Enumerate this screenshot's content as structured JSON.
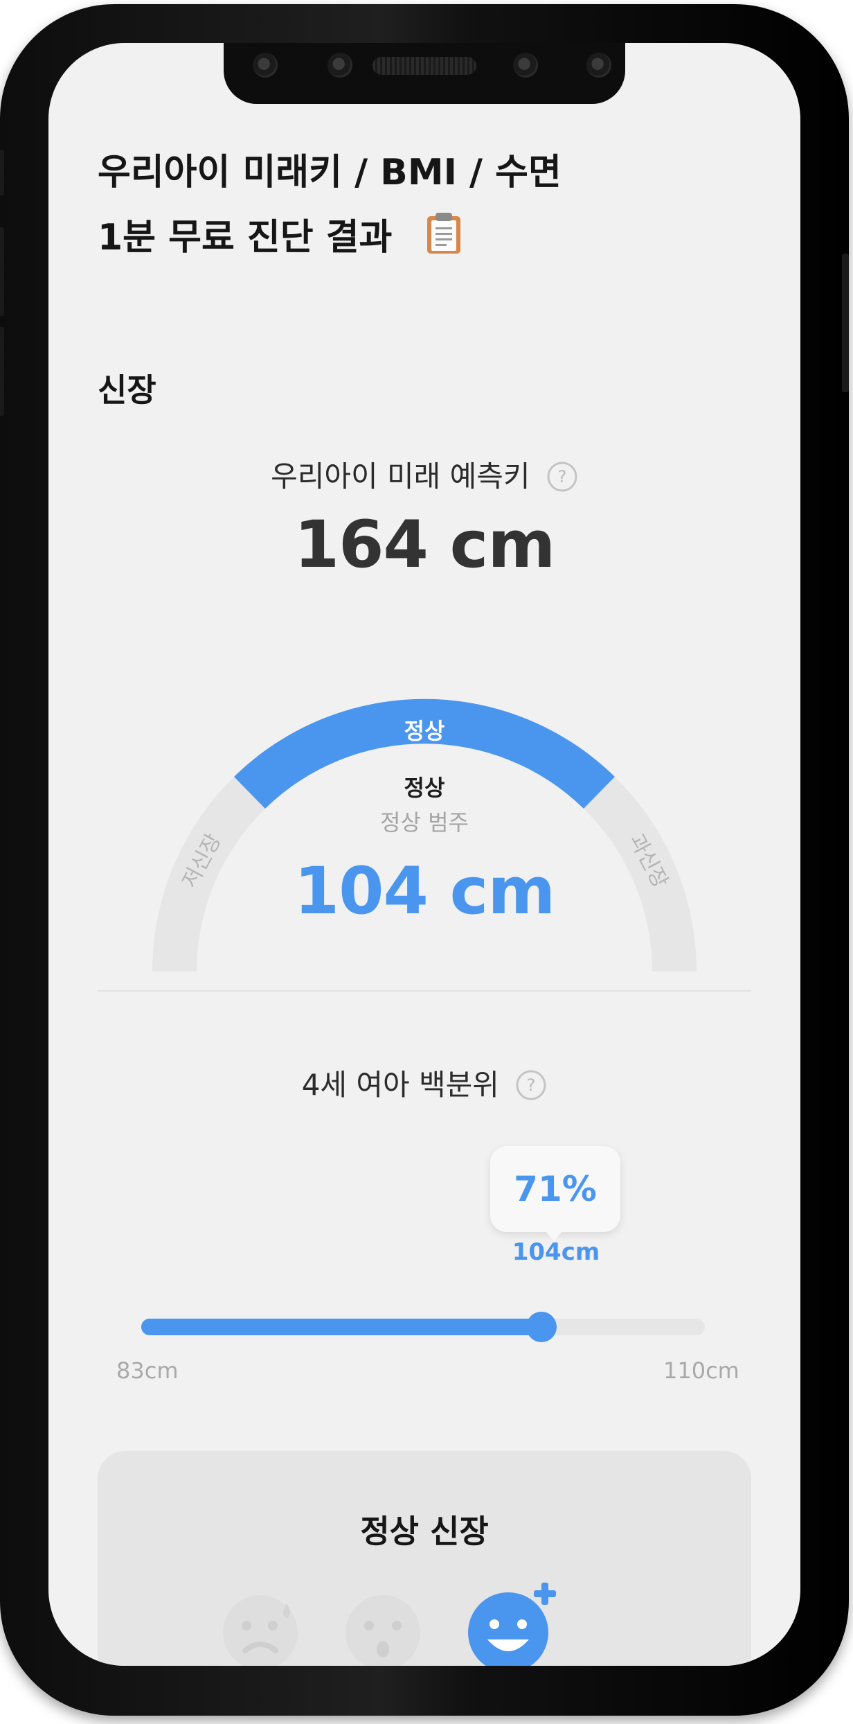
{
  "header": {
    "title": "우리아이 미래키 / BMI / 수면\n1분 무료 진단 결과"
  },
  "height_section": {
    "title": "신장",
    "prediction_label": "우리아이 미래 예측키",
    "prediction_value": "164 cm",
    "gauge": {
      "segments": [
        "저신장",
        "정상",
        "과신장"
      ],
      "active_segment": "정상",
      "status": "정상",
      "sub_status": "정상 범주",
      "current_value": "104 cm"
    },
    "percentile": {
      "label": "4세 여아 백분위",
      "value": "71%",
      "percent": 71,
      "marker_label": "104cm",
      "min_label": "83cm",
      "max_label": "110cm"
    },
    "result_card": {
      "title": "정상 신장",
      "faces": [
        "sweat-face-icon",
        "neutral-face-icon",
        "happy-face-icon"
      ],
      "active_face": "happy-face-icon"
    }
  },
  "colors": {
    "accent": "#4a96ee",
    "gauge_inactive": "#e6e6e6",
    "screen_bg": "#f1f1f1",
    "card_bg": "#e5e5e5"
  }
}
